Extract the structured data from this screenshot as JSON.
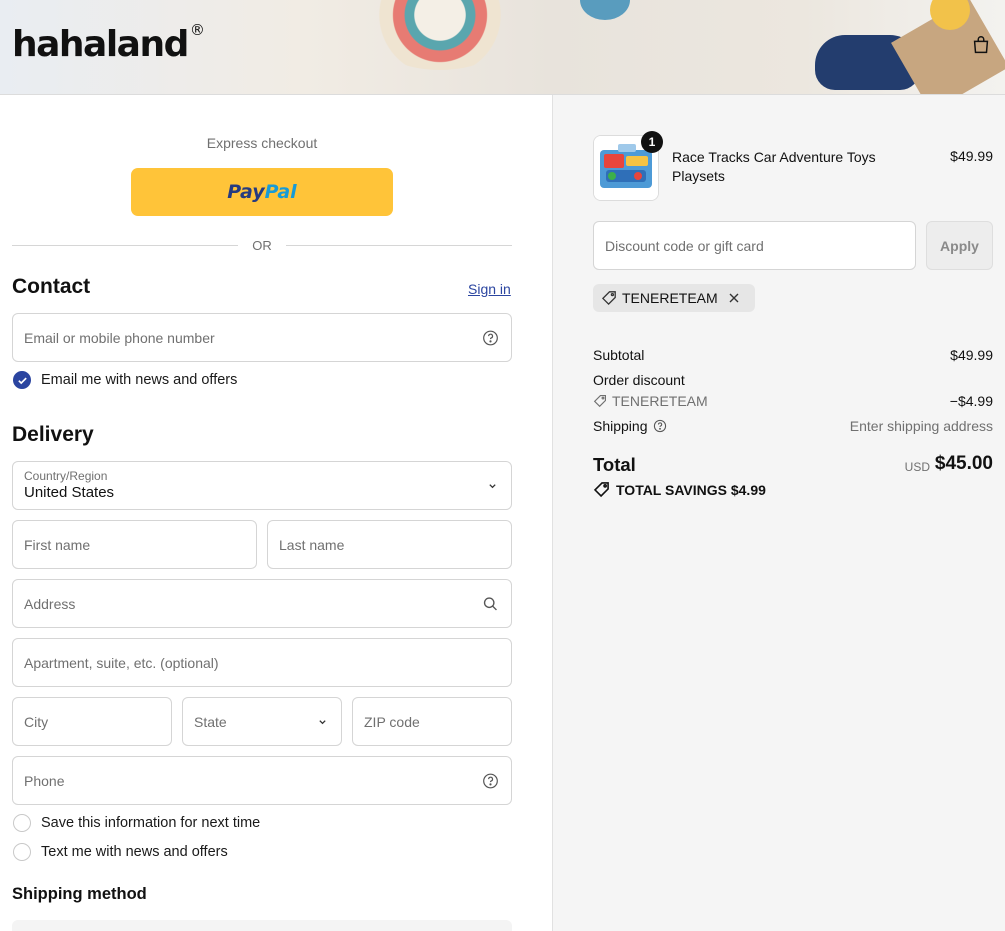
{
  "brand": {
    "logo_text": "hahaland",
    "logo_mark": "®"
  },
  "express": {
    "label": "Express checkout",
    "paypal_pay": "Pay",
    "paypal_pal": "Pal",
    "or_text": "OR"
  },
  "contact": {
    "title": "Contact",
    "sign_in": "Sign in",
    "email_placeholder": "Email or mobile phone number",
    "news_label": "Email me with news and offers",
    "news_checked": true
  },
  "delivery": {
    "title": "Delivery",
    "country_label": "Country/Region",
    "country_value": "United States",
    "first_name": "First name",
    "last_name": "Last name",
    "address": "Address",
    "apartment": "Apartment, suite, etc. (optional)",
    "city": "City",
    "state": "State",
    "zip": "ZIP code",
    "phone": "Phone",
    "save_info": "Save this information for next time",
    "text_news": "Text me with news and offers"
  },
  "shipping": {
    "title": "Shipping method"
  },
  "summary": {
    "product": {
      "name": "Race Tracks Car Adventure Toys Playsets",
      "price": "$49.99",
      "quantity": "1"
    },
    "discount_placeholder": "Discount code or gift card",
    "apply": "Apply",
    "applied_code": "TENERETEAM",
    "subtotal_label": "Subtotal",
    "subtotal_value": "$49.99",
    "order_discount_label": "Order discount",
    "discount_code": "TENERETEAM",
    "discount_value": "−$4.99",
    "shipping_label": "Shipping",
    "shipping_value": "Enter shipping address",
    "total_label": "Total",
    "currency": "USD",
    "total_value": "$45.00",
    "savings": "TOTAL SAVINGS $4.99"
  },
  "colors": {
    "accent": "#2b45a0",
    "paypal": "#ffc439",
    "summary_bg": "#f5f5f5"
  }
}
